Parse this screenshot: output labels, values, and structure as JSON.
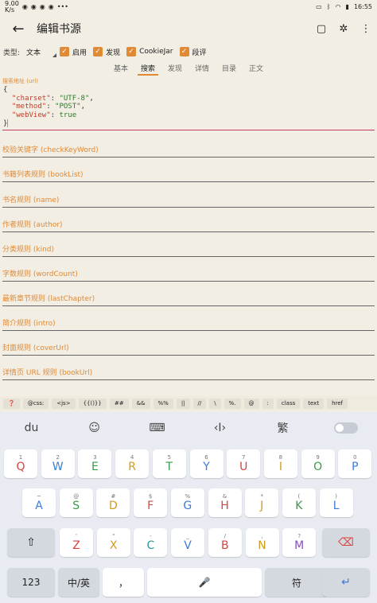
{
  "status": {
    "net": "9.00",
    "speed": "K/s",
    "time": "16:55",
    "right_icons": [
      "bluetooth",
      "wifi",
      "battery"
    ]
  },
  "appbar": {
    "title": "编辑书源",
    "back": "←",
    "save_icon": "▢",
    "debug_icon": "✲",
    "more_icon": "⋮"
  },
  "options": {
    "type_label": "类型:",
    "type_value": "文本",
    "enabled": "启用",
    "discover": "发现",
    "cookiejar": "CookieJar",
    "review": "段评",
    "check": "✓"
  },
  "tabs": [
    "基本",
    "搜索",
    "发现",
    "详情",
    "目录",
    "正文"
  ],
  "search_url": {
    "label": "搜索地址 (url)",
    "open": "{",
    "l1k": "\"charset\"",
    "l1v": "\"UTF-8\"",
    "l2k": "\"method\"",
    "l2v": "\"POST\"",
    "l3k": "\"webView\"",
    "l3v": "true",
    "close": "}"
  },
  "rules": [
    "校验关键字 (checkKeyWord)",
    "书籍列表规则 (bookList)",
    "书名规则 (name)",
    "作者规则 (author)",
    "分类规则 (kind)",
    "字数规则 (wordCount)",
    "最新章节规则 (lastChapter)",
    "简介规则 (intro)",
    "封面规则 (coverUrl)",
    "详情页 URL 规则 (bookUrl)"
  ],
  "helper_chips": [
    "❓",
    "@css:",
    "<js>",
    "{{()}}",
    "##",
    "&&",
    "%%",
    "||",
    "//",
    "\\",
    "%.",
    "@",
    ":",
    "class",
    "text",
    "href"
  ],
  "keyboard": {
    "top": [
      "du",
      "☺",
      "⌨",
      "‹I›",
      "繁"
    ],
    "row1": [
      [
        "1",
        "Q",
        "c-red"
      ],
      [
        "2",
        "W",
        "c-blue"
      ],
      [
        "3",
        "E",
        "c-green"
      ],
      [
        "4",
        "R",
        "c-orange"
      ],
      [
        "5",
        "T",
        "c-green"
      ],
      [
        "6",
        "Y",
        "c-blue"
      ],
      [
        "7",
        "U",
        "c-red"
      ],
      [
        "8",
        "I",
        "c-orange"
      ],
      [
        "9",
        "O",
        "c-green"
      ],
      [
        "0",
        "P",
        "c-blue"
      ]
    ],
    "row2": [
      [
        "~",
        "A",
        "c-blue"
      ],
      [
        "@",
        "S",
        "c-green"
      ],
      [
        "#",
        "D",
        "c-orange"
      ],
      [
        "$",
        "F",
        "c-red"
      ],
      [
        "%",
        "G",
        "c-blue"
      ],
      [
        "&",
        "H",
        "c-red"
      ],
      [
        "*",
        "J",
        "c-orange"
      ],
      [
        "(",
        "K",
        "c-green"
      ],
      [
        ")",
        "L",
        "c-blue"
      ]
    ],
    "row3": [
      [
        "'",
        "Z",
        "c-red"
      ],
      [
        "\"",
        "X",
        "c-orange"
      ],
      [
        "-",
        "C",
        "c-teal"
      ],
      [
        "_",
        "V",
        "c-blue"
      ],
      [
        "/",
        "B",
        "c-red"
      ],
      [
        ",",
        "N",
        "c-orange"
      ],
      [
        "?",
        "M",
        "c-purple"
      ]
    ],
    "shift": "⇧",
    "del": "⌫",
    "num": "123",
    "lang": "中/英",
    "comma": "，",
    "mic": "🎤",
    "period": "符",
    "enter": "↵"
  }
}
